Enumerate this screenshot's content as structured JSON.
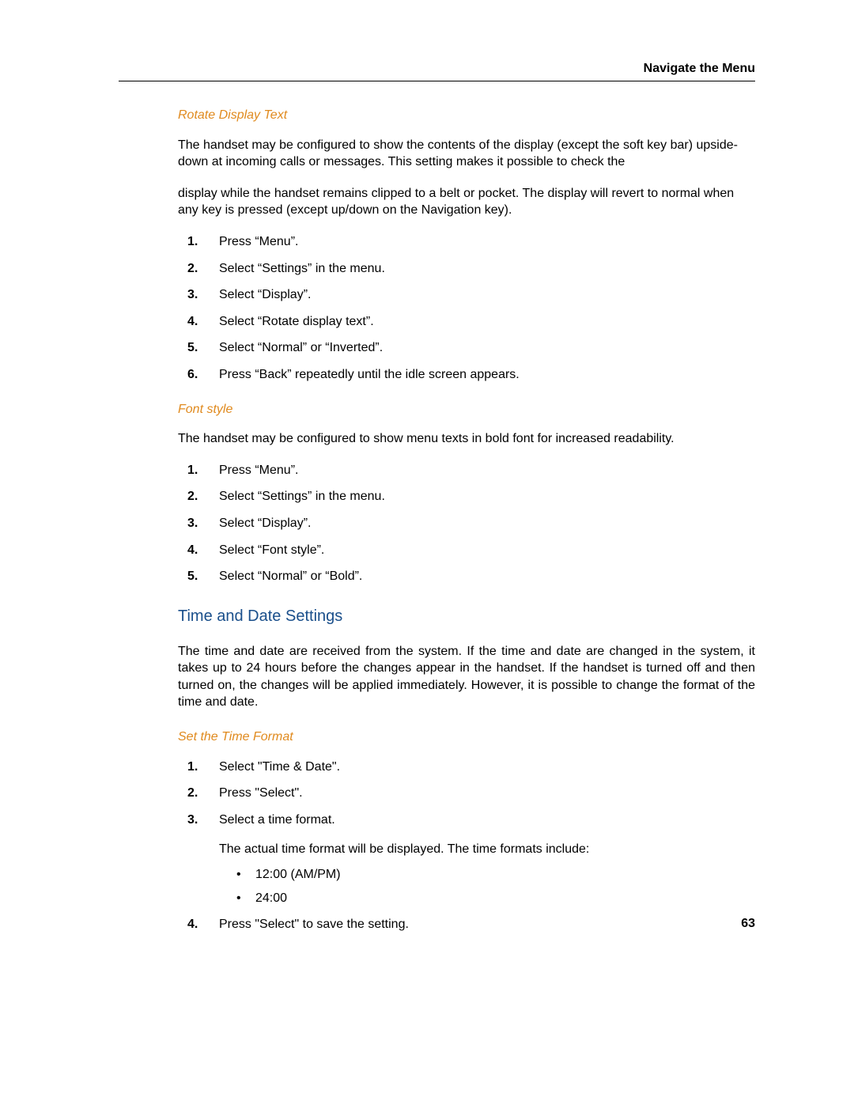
{
  "header": {
    "running_title": "Navigate the Menu"
  },
  "footer": {
    "page_number": "63"
  },
  "sections": {
    "rotate_display": {
      "heading": "Rotate Display Text",
      "para1": "The handset may be configured to show the contents of the display (except the soft key bar) upside-down at incoming calls or messages. This setting makes it possible to check the",
      "para2": "display while the handset remains clipped to a belt or pocket. The display will revert to normal when any key is pressed (except up/down on the Navigation key).",
      "steps": [
        "Press “Menu”.",
        "Select “Settings” in the menu.",
        "Select “Display”.",
        "Select “Rotate display text”.",
        "Select “Normal” or “Inverted”.",
        "Press “Back” repeatedly until the idle screen appears."
      ]
    },
    "font_style": {
      "heading": "Font style",
      "para1": "The handset may be configured to show menu texts in bold font for increased readability.",
      "steps": [
        "Press “Menu”.",
        "Select “Settings” in the menu.",
        "Select “Display”.",
        "Select “Font style”.",
        "Select “Normal” or “Bold”."
      ]
    },
    "time_date": {
      "title": "Time and Date Settings",
      "intro": "The time and date are received from the system. If the time and date are changed in the system, it takes up to 24 hours before the changes appear in the handset. If the handset is turned off and then turned on, the changes will be applied immediately. However, it is possible to change the format of the time and date.",
      "set_time_format": {
        "heading": "Set the Time Format",
        "step1": "Select \"Time & Date\".",
        "step2": "Press \"Select\".",
        "step3": "Select a time format.",
        "step3_note": "The actual time format will be displayed. The time formats include:",
        "step3_bullets": [
          "12:00 (AM/PM)",
          "24:00"
        ],
        "step4": "Press \"Select\" to save the setting."
      }
    }
  }
}
